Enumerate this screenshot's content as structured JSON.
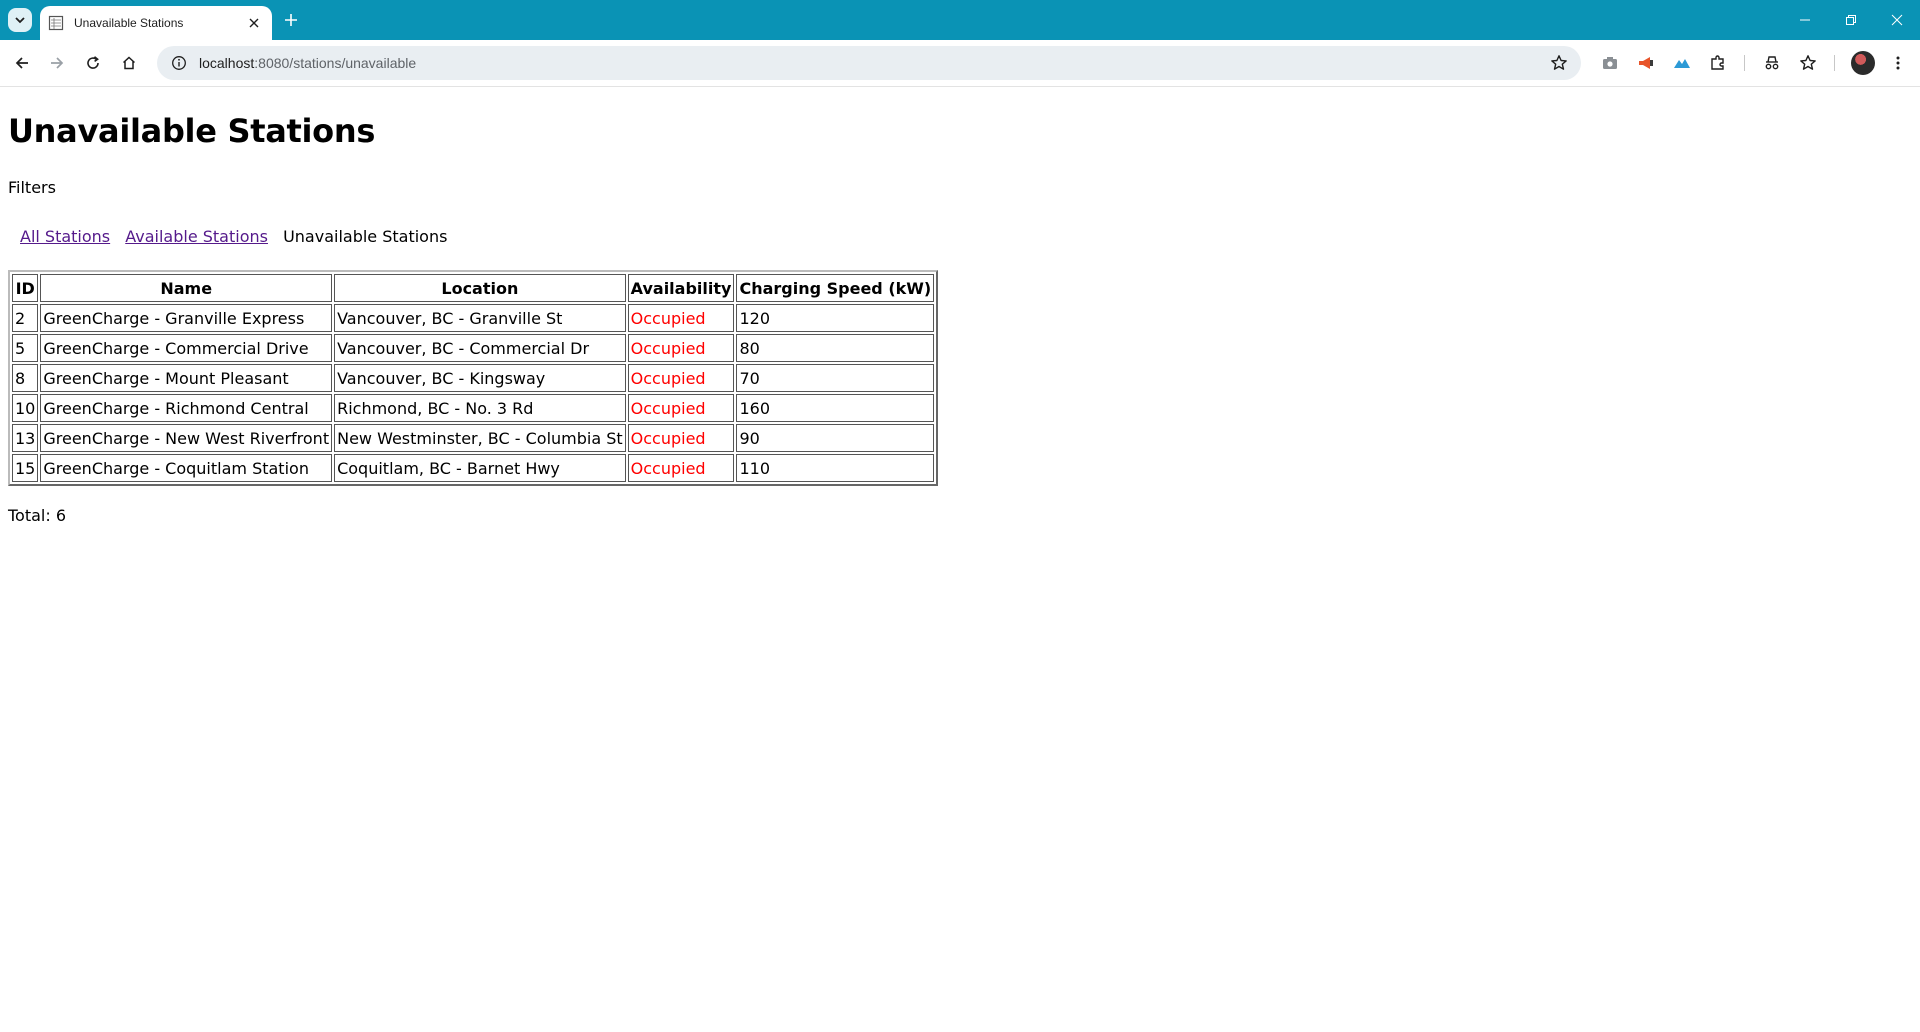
{
  "browser": {
    "tab_title": "Unavailable Stations",
    "url_host": "localhost",
    "url_port_path": ":8080/stations/unavailable"
  },
  "page": {
    "title": "Unavailable Stations",
    "filters_label": "Filters",
    "filter_links": {
      "all": "All Stations",
      "available": "Available Stations",
      "current": "Unavailable Stations"
    },
    "table": {
      "headers": [
        "ID",
        "Name",
        "Location",
        "Availability",
        "Charging Speed (kW)"
      ],
      "rows": [
        {
          "id": "2",
          "name": "GreenCharge - Granville Express",
          "location": "Vancouver, BC - Granville St",
          "availability": "Occupied",
          "speed": "120"
        },
        {
          "id": "5",
          "name": "GreenCharge - Commercial Drive",
          "location": "Vancouver, BC - Commercial Dr",
          "availability": "Occupied",
          "speed": "80"
        },
        {
          "id": "8",
          "name": "GreenCharge - Mount Pleasant",
          "location": "Vancouver, BC - Kingsway",
          "availability": "Occupied",
          "speed": "70"
        },
        {
          "id": "10",
          "name": "GreenCharge - Richmond Central",
          "location": "Richmond, BC - No. 3 Rd",
          "availability": "Occupied",
          "speed": "160"
        },
        {
          "id": "13",
          "name": "GreenCharge - New West Riverfront",
          "location": "New Westminster, BC - Columbia St",
          "availability": "Occupied",
          "speed": "90"
        },
        {
          "id": "15",
          "name": "GreenCharge - Coquitlam Station",
          "location": "Coquitlam, BC - Barnet Hwy",
          "availability": "Occupied",
          "speed": "110"
        }
      ]
    },
    "total": "Total: 6"
  },
  "colors": {
    "tabbar": "#0a93b5",
    "visited_link": "#551a8b",
    "occupied": "#ff0000"
  }
}
